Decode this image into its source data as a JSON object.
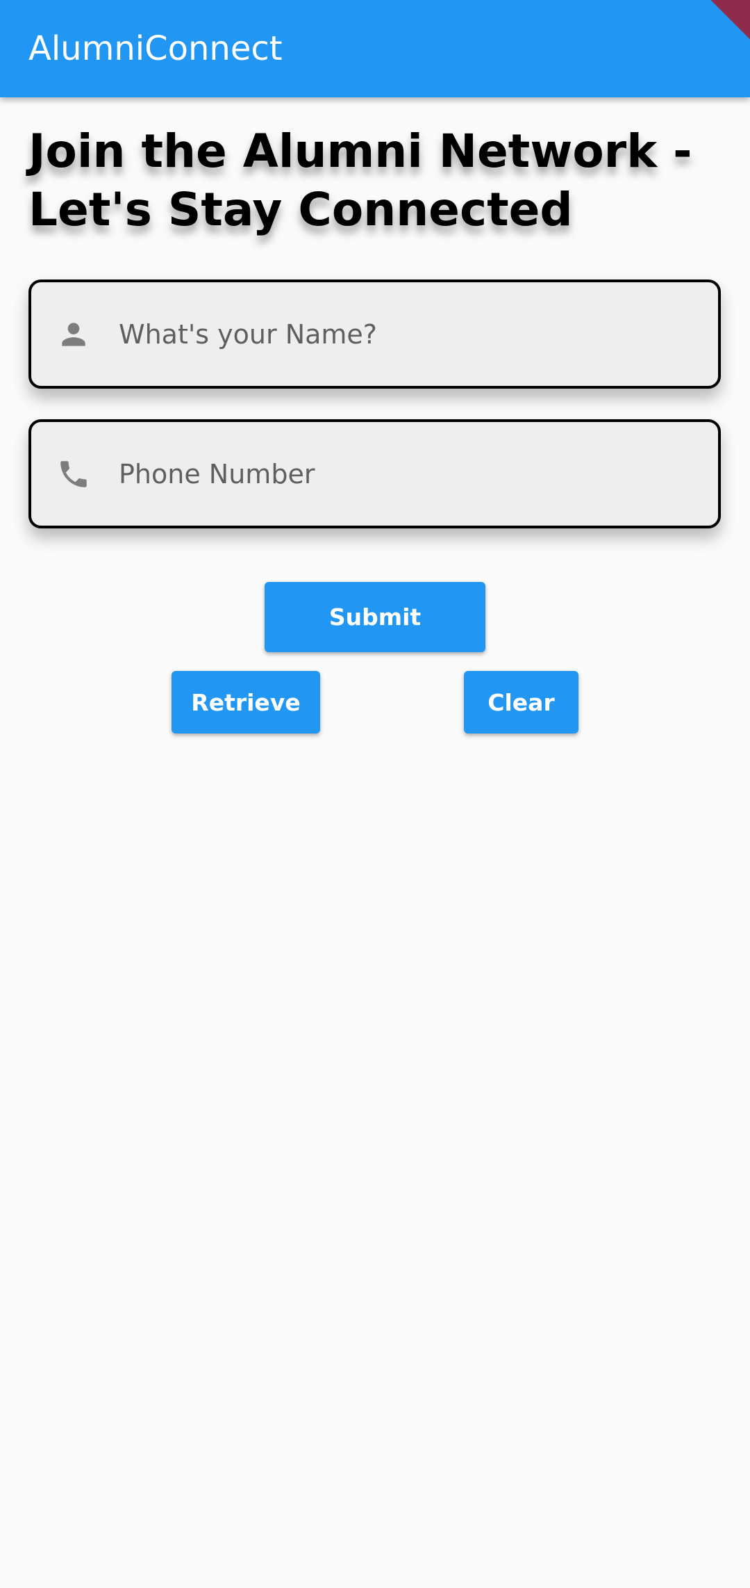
{
  "app_bar": {
    "title": "AlumniConnect",
    "color": "#2196f3"
  },
  "page": {
    "heading": "Join the Alumni Network - Let's Stay Connected"
  },
  "form": {
    "name_field": {
      "icon": "person-icon",
      "placeholder": "What's your Name?",
      "value": ""
    },
    "phone_field": {
      "icon": "phone-icon",
      "placeholder": "Phone Number",
      "value": ""
    }
  },
  "actions": {
    "submit_label": "Submit",
    "retrieve_label": "Retrieve",
    "clear_label": "Clear",
    "button_color": "#2196f3"
  }
}
